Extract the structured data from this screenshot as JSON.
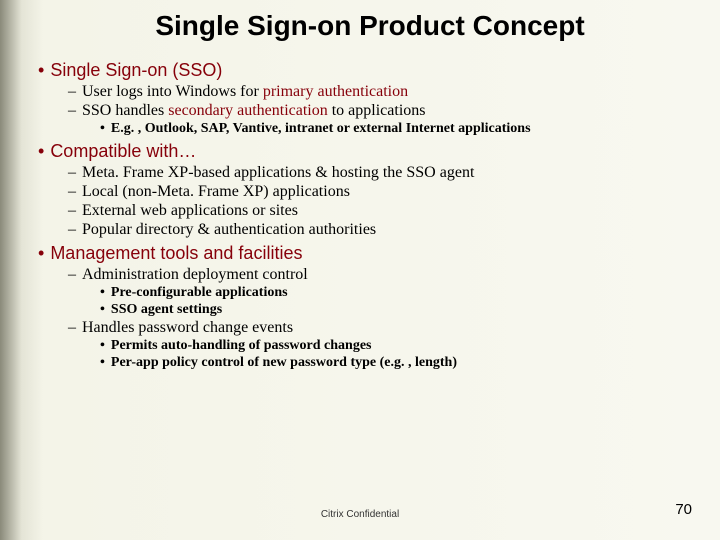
{
  "title": "Single Sign-on Product Concept",
  "b1": {
    "heading": "Single Sign-on (SSO)",
    "s1_pre": "User logs into Windows for ",
    "s1_hl": "primary authentication",
    "s2_pre": "SSO handles ",
    "s2_hl": "secondary authentication",
    "s2_post": " to applications",
    "ex": "E.g. , Outlook, SAP, Vantive, intranet or external Internet applications"
  },
  "b2": {
    "heading": "Compatible with…",
    "i1": "Meta. Frame XP-based applications & hosting the SSO agent",
    "i2": "Local (non-Meta. Frame XP) applications",
    "i3": "External web applications or sites",
    "i4": "Popular directory & authentication authorities"
  },
  "b3": {
    "heading": "Management tools and facilities",
    "s1": "Administration deployment control",
    "s1a": "Pre-configurable applications",
    "s1b": "SSO agent settings",
    "s2": "Handles password change events",
    "s2a": "Permits auto-handling of password changes",
    "s2b": "Per-app policy control of new password type (e.g. , length)"
  },
  "footer": "Citrix Confidential",
  "page": "70"
}
